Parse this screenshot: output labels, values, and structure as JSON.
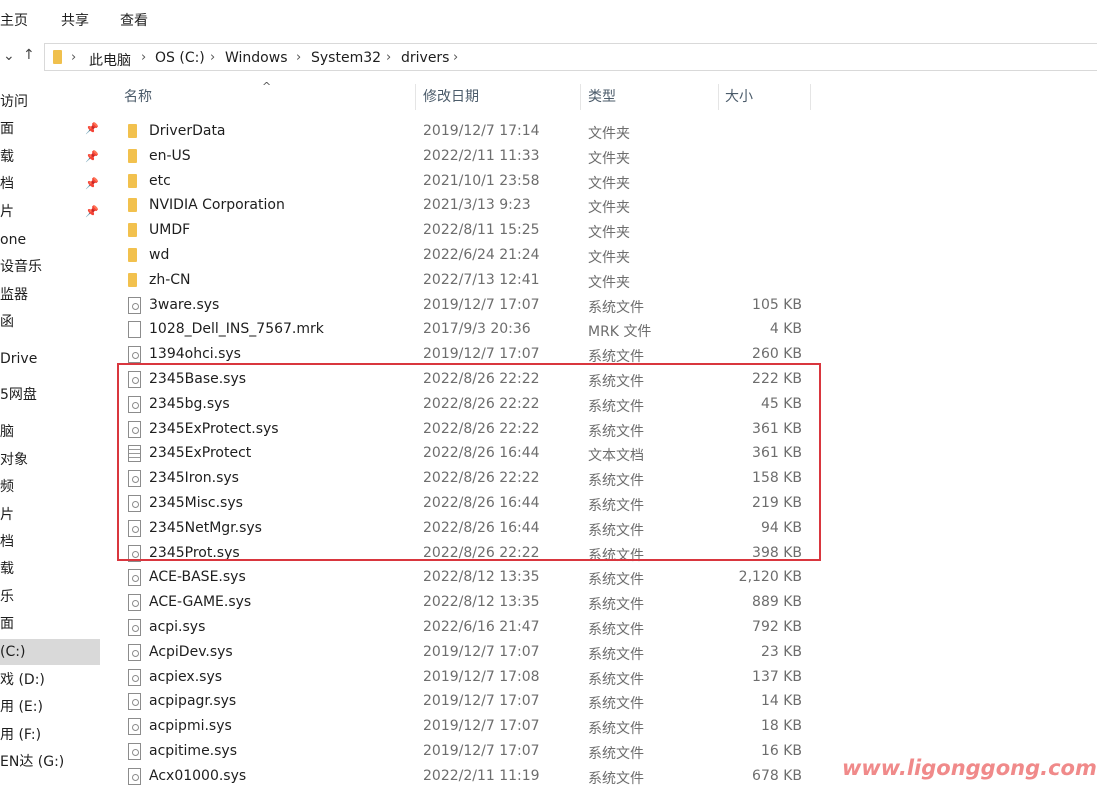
{
  "ribbon": {
    "tabs": [
      "主页",
      "共享",
      "查看"
    ]
  },
  "nav": {
    "back": "‹",
    "chevron": "⌄",
    "up": "↑"
  },
  "address": {
    "crumbs": [
      "此电脑",
      "OS (C:)",
      "Windows",
      "System32",
      "drivers"
    ],
    "separator": "›"
  },
  "sidebar": {
    "items": [
      {
        "label": "访问",
        "pinned": false
      },
      {
        "label": "面",
        "pinned": true
      },
      {
        "label": "载",
        "pinned": true
      },
      {
        "label": "档",
        "pinned": true
      },
      {
        "label": "片",
        "pinned": true
      },
      {
        "label": "one",
        "pinned": false
      },
      {
        "label": "设音乐",
        "pinned": false
      },
      {
        "label": "监器",
        "pinned": false
      },
      {
        "label": "函",
        "pinned": false
      },
      {
        "label": "Drive",
        "pinned": false
      },
      {
        "label": "5网盘",
        "pinned": false
      },
      {
        "label": "脑",
        "pinned": false
      },
      {
        "label": "对象",
        "pinned": false
      },
      {
        "label": "频",
        "pinned": false
      },
      {
        "label": "片",
        "pinned": false
      },
      {
        "label": "档",
        "pinned": false
      },
      {
        "label": "载",
        "pinned": false
      },
      {
        "label": "乐",
        "pinned": false
      },
      {
        "label": "面",
        "pinned": false
      },
      {
        "label": "(C:)",
        "pinned": false,
        "selected": true
      },
      {
        "label": "戏 (D:)",
        "pinned": false
      },
      {
        "label": "用 (E:)",
        "pinned": false
      },
      {
        "label": "用 (F:)",
        "pinned": false
      },
      {
        "label": "EN达 (G:)",
        "pinned": false
      }
    ],
    "pin_glyph": "📌"
  },
  "columns": {
    "name": "名称",
    "date": "修改日期",
    "type": "类型",
    "size": "大小",
    "sort_glyph": "^"
  },
  "files": [
    {
      "icon": "folder-icon",
      "name": "DriverData",
      "date": "2019/12/7 17:14",
      "type": "文件夹",
      "size": ""
    },
    {
      "icon": "folder-icon",
      "name": "en-US",
      "date": "2022/2/11 11:33",
      "type": "文件夹",
      "size": ""
    },
    {
      "icon": "folder-icon",
      "name": "etc",
      "date": "2021/10/1 23:58",
      "type": "文件夹",
      "size": ""
    },
    {
      "icon": "folder-icon",
      "name": "NVIDIA Corporation",
      "date": "2021/3/13 9:23",
      "type": "文件夹",
      "size": ""
    },
    {
      "icon": "folder-icon",
      "name": "UMDF",
      "date": "2022/8/11 15:25",
      "type": "文件夹",
      "size": ""
    },
    {
      "icon": "folder-icon",
      "name": "wd",
      "date": "2022/6/24 21:24",
      "type": "文件夹",
      "size": ""
    },
    {
      "icon": "folder-icon",
      "name": "zh-CN",
      "date": "2022/7/13 12:41",
      "type": "文件夹",
      "size": ""
    },
    {
      "icon": "sys-file-icon",
      "name": "3ware.sys",
      "date": "2019/12/7 17:07",
      "type": "系统文件",
      "size": "105 KB"
    },
    {
      "icon": "generic-file-icon",
      "name": "1028_Dell_INS_7567.mrk",
      "date": "2017/9/3 20:36",
      "type": "MRK 文件",
      "size": "4 KB"
    },
    {
      "icon": "sys-file-icon",
      "name": "1394ohci.sys",
      "date": "2019/12/7 17:07",
      "type": "系统文件",
      "size": "260 KB"
    },
    {
      "icon": "sys-file-icon",
      "name": "2345Base.sys",
      "date": "2022/8/26 22:22",
      "type": "系统文件",
      "size": "222 KB"
    },
    {
      "icon": "sys-file-icon",
      "name": "2345bg.sys",
      "date": "2022/8/26 22:22",
      "type": "系统文件",
      "size": "45 KB"
    },
    {
      "icon": "sys-file-icon",
      "name": "2345ExProtect.sys",
      "date": "2022/8/26 22:22",
      "type": "系统文件",
      "size": "361 KB"
    },
    {
      "icon": "text-file-icon",
      "name": "2345ExProtect",
      "date": "2022/8/26 16:44",
      "type": "文本文档",
      "size": "361 KB"
    },
    {
      "icon": "sys-file-icon",
      "name": "2345Iron.sys",
      "date": "2022/8/26 22:22",
      "type": "系统文件",
      "size": "158 KB"
    },
    {
      "icon": "sys-file-icon",
      "name": "2345Misc.sys",
      "date": "2022/8/26 16:44",
      "type": "系统文件",
      "size": "219 KB"
    },
    {
      "icon": "sys-file-icon",
      "name": "2345NetMgr.sys",
      "date": "2022/8/26 16:44",
      "type": "系统文件",
      "size": "94 KB"
    },
    {
      "icon": "sys-file-icon",
      "name": "2345Prot.sys",
      "date": "2022/8/26 22:22",
      "type": "系统文件",
      "size": "398 KB"
    },
    {
      "icon": "sys-file-icon",
      "name": "ACE-BASE.sys",
      "date": "2022/8/12 13:35",
      "type": "系统文件",
      "size": "2,120 KB"
    },
    {
      "icon": "sys-file-icon",
      "name": "ACE-GAME.sys",
      "date": "2022/8/12 13:35",
      "type": "系统文件",
      "size": "889 KB"
    },
    {
      "icon": "sys-file-icon",
      "name": "acpi.sys",
      "date": "2022/6/16 21:47",
      "type": "系统文件",
      "size": "792 KB"
    },
    {
      "icon": "sys-file-icon",
      "name": "AcpiDev.sys",
      "date": "2019/12/7 17:07",
      "type": "系统文件",
      "size": "23 KB"
    },
    {
      "icon": "sys-file-icon",
      "name": "acpiex.sys",
      "date": "2019/12/7 17:08",
      "type": "系统文件",
      "size": "137 KB"
    },
    {
      "icon": "sys-file-icon",
      "name": "acpipagr.sys",
      "date": "2019/12/7 17:07",
      "type": "系统文件",
      "size": "14 KB"
    },
    {
      "icon": "sys-file-icon",
      "name": "acpipmi.sys",
      "date": "2019/12/7 17:07",
      "type": "系统文件",
      "size": "18 KB"
    },
    {
      "icon": "sys-file-icon",
      "name": "acpitime.sys",
      "date": "2019/12/7 17:07",
      "type": "系统文件",
      "size": "16 KB"
    },
    {
      "icon": "sys-file-icon",
      "name": "Acx01000.sys",
      "date": "2022/2/11 11:19",
      "type": "系统文件",
      "size": "678 KB"
    }
  ],
  "highlight_color": "#d9363e",
  "watermark": "www.ligonggong.com"
}
